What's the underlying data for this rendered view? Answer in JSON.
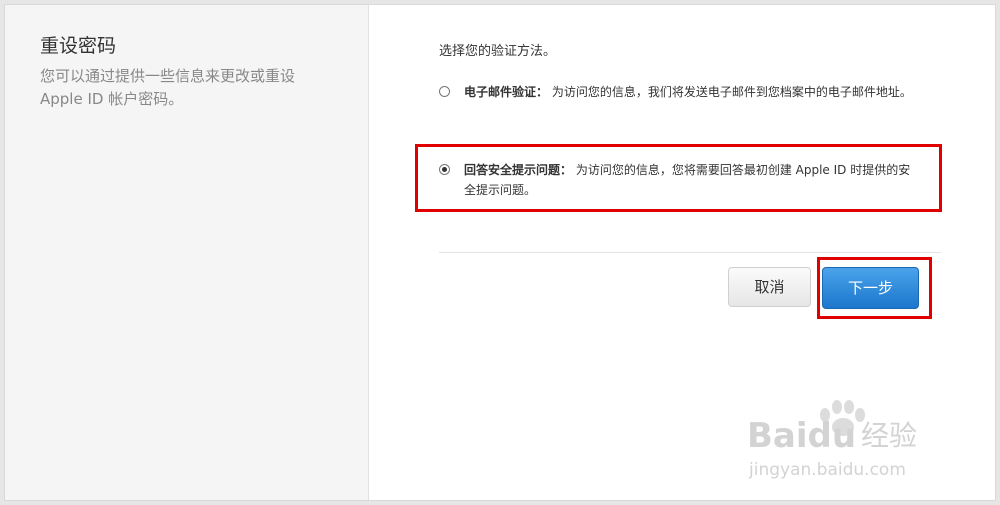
{
  "sidebar": {
    "title": "重设密码",
    "description": "您可以通过提供一些信息来更改或重设 Apple ID 帐户密码。"
  },
  "main": {
    "prompt": "选择您的验证方法。",
    "options": [
      {
        "label": "电子邮件验证：",
        "description": "为访问您的信息，我们将发送电子邮件到您档案中的电子邮件地址。",
        "selected": false
      },
      {
        "label": "回答安全提示问题：",
        "description": "为访问您的信息，您将需要回答最初创建 Apple ID 时提供的安全提示问题。",
        "selected": true
      }
    ],
    "buttons": {
      "cancel_label": "取消",
      "next_label": "下一步"
    }
  },
  "watermark": {
    "brand": "Bai",
    "brand_suffix": "du",
    "product": "经验",
    "url": "jingyan.baidu.com"
  },
  "colors": {
    "annotation_red": "#e00000",
    "primary_blue": "#1c76cc"
  }
}
